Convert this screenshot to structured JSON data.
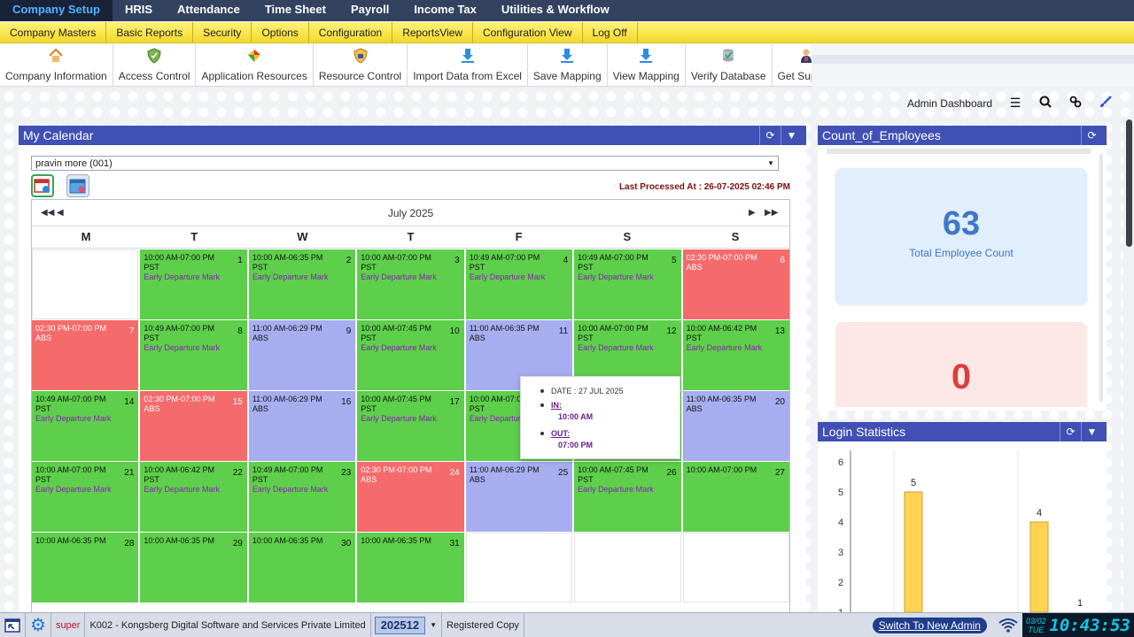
{
  "topnav": [
    "Company Setup",
    "HRIS",
    "Attendance",
    "Time Sheet",
    "Payroll",
    "Income Tax",
    "Utilities & Workflow"
  ],
  "submenu": [
    "Company Masters",
    "Basic Reports",
    "Security",
    "Options",
    "Configuration",
    "ReportsView",
    "Configuration View",
    "Log Off"
  ],
  "ribbon": [
    {
      "label": "Company Information",
      "icon": "house-icon"
    },
    {
      "label": "Access Control",
      "icon": "shield-icon"
    },
    {
      "label": "Application Resources",
      "icon": "puzzle-icon"
    },
    {
      "label": "Resource Control",
      "icon": "shield-lock-icon"
    },
    {
      "label": "Import Data from Excel",
      "icon": "download-icon"
    },
    {
      "label": "Save Mapping",
      "icon": "download-icon"
    },
    {
      "label": "View Mapping",
      "icon": "download-icon"
    },
    {
      "label": "Verify Database",
      "icon": "database-check-icon"
    },
    {
      "label": "Get Support",
      "icon": "support-person-icon"
    }
  ],
  "admin": {
    "label": "Admin Dashboard"
  },
  "calendar": {
    "title": "My Calendar",
    "employee": "pravin  more (001)",
    "last_processed": "Last Processed At : 26-07-2025 02:46 PM",
    "month": "July 2025",
    "weekdays": [
      "M",
      "T",
      "W",
      "T",
      "F",
      "S",
      "S"
    ],
    "days": [
      null,
      {
        "d": "1",
        "t": "10:00 AM-07:00 PM",
        "s": "PST",
        "m": "Early Departure Mark",
        "c": "green"
      },
      {
        "d": "2",
        "t": "10:00 AM-06:35 PM",
        "s": "PST",
        "m": "Early Departure Mark",
        "c": "green"
      },
      {
        "d": "3",
        "t": "10:00 AM-07:00 PM",
        "s": "PST",
        "m": "Early Departure Mark",
        "c": "green"
      },
      {
        "d": "4",
        "t": "10:49 AM-07:00 PM",
        "s": "PST",
        "m": "Early Departure Mark",
        "c": "green"
      },
      {
        "d": "5",
        "t": "10:49 AM-07:00 PM",
        "s": "PST",
        "m": "Early Departure Mark",
        "c": "green"
      },
      {
        "d": "6",
        "t": "02:30 PM-07:00 PM",
        "s": "ABS",
        "m": "",
        "c": "red"
      },
      {
        "d": "7",
        "t": "02:30 PM-07:00 PM",
        "s": "ABS",
        "m": "",
        "c": "red"
      },
      {
        "d": "8",
        "t": "10:49 AM-07:00 PM",
        "s": "PST",
        "m": "Early Departure Mark",
        "c": "green"
      },
      {
        "d": "9",
        "t": "11:00 AM-06:29 PM",
        "s": "ABS",
        "m": "",
        "c": "blue"
      },
      {
        "d": "10",
        "t": "10:00 AM-07:45 PM",
        "s": "PST",
        "m": "Early Departure Mark",
        "c": "green"
      },
      {
        "d": "11",
        "t": "11:00 AM-06:35 PM",
        "s": "ABS",
        "m": "",
        "c": "blue"
      },
      {
        "d": "12",
        "t": "10:00 AM-07:00 PM",
        "s": "PST",
        "m": "Early Departure Mark",
        "c": "green"
      },
      {
        "d": "13",
        "t": "10:00 AM-06:42 PM",
        "s": "PST",
        "m": "Early Departure Mark",
        "c": "green"
      },
      {
        "d": "14",
        "t": "10:49 AM-07:00 PM",
        "s": "PST",
        "m": "Early Departure Mark",
        "c": "green"
      },
      {
        "d": "15",
        "t": "02:30 PM-07:00 PM",
        "s": "ABS",
        "m": "",
        "c": "red"
      },
      {
        "d": "16",
        "t": "11:00 AM-06:29 PM",
        "s": "ABS",
        "m": "",
        "c": "blue"
      },
      {
        "d": "17",
        "t": "10:00 AM-07:45 PM",
        "s": "PST",
        "m": "Early Departure Mark",
        "c": "green"
      },
      {
        "d": "",
        "t": "10:00 AM-07:0",
        "s": "PST",
        "m": "Early Departur",
        "c": "green"
      },
      {
        "d": "",
        "t": "",
        "s": "",
        "m": "",
        "c": "green"
      },
      {
        "d": "20",
        "t": "11:00 AM-06:35 PM",
        "s": "ABS",
        "m": "",
        "c": "blue"
      },
      {
        "d": "21",
        "t": "10:00 AM-07:00 PM",
        "s": "PST",
        "m": "Early Departure Mark",
        "c": "green"
      },
      {
        "d": "22",
        "t": "10:00 AM-06:42 PM",
        "s": "PST",
        "m": "Early Departure Mark",
        "c": "green"
      },
      {
        "d": "23",
        "t": "10:49 AM-07:00 PM",
        "s": "PST",
        "m": "Early Departure Mark",
        "c": "green"
      },
      {
        "d": "24",
        "t": "02:30 PM-07:00 PM",
        "s": "ABS",
        "m": "",
        "c": "red"
      },
      {
        "d": "25",
        "t": "11:00 AM-06:29 PM",
        "s": "ABS",
        "m": "",
        "c": "blue"
      },
      {
        "d": "26",
        "t": "10:00 AM-07:45 PM",
        "s": "PST",
        "m": "Early Departure Mark",
        "c": "green"
      },
      {
        "d": "27",
        "t": "10:00 AM-07:00 PM",
        "s": "",
        "m": "",
        "c": "green"
      },
      {
        "d": "28",
        "t": "10:00 AM-06:35 PM",
        "s": "",
        "m": "",
        "c": "green"
      },
      {
        "d": "29",
        "t": "10:00 AM-06:35 PM",
        "s": "",
        "m": "",
        "c": "green"
      },
      {
        "d": "30",
        "t": "10:00 AM-06:35 PM",
        "s": "",
        "m": "",
        "c": "green"
      },
      {
        "d": "31",
        "t": "10:00 AM-06:35 PM",
        "s": "",
        "m": "",
        "c": "green"
      },
      null,
      null,
      null
    ],
    "tooltip": {
      "date": "DATE : 27 JUL 2025",
      "in_label": "IN:",
      "in_value": "10:00 AM",
      "out_label": "OUT:",
      "out_value": "07:00 PM"
    }
  },
  "count_panel": {
    "title": "Count_of_Employees",
    "total": "63",
    "total_label": "Total Employee Count",
    "second": "0"
  },
  "login_panel": {
    "title": "Login Statistics"
  },
  "chart_data": {
    "type": "bar",
    "title": "Login Statistics",
    "ylim": [
      0,
      6
    ],
    "yticks": [
      "6",
      "5",
      "4",
      "3",
      "2",
      "1"
    ],
    "values": [
      5,
      4,
      1
    ],
    "value_labels": [
      "5",
      "4",
      "1"
    ],
    "bar_color": "#ffd452"
  },
  "status": {
    "user": "super",
    "company": "K002 - Kongsberg Digital Software and Services Private Limited",
    "period": "202512",
    "registered": "Registered Copy",
    "switch": "Switch To New Admin",
    "date_top": "03/02",
    "date_bottom": "TUE",
    "time": "10:43:53"
  }
}
